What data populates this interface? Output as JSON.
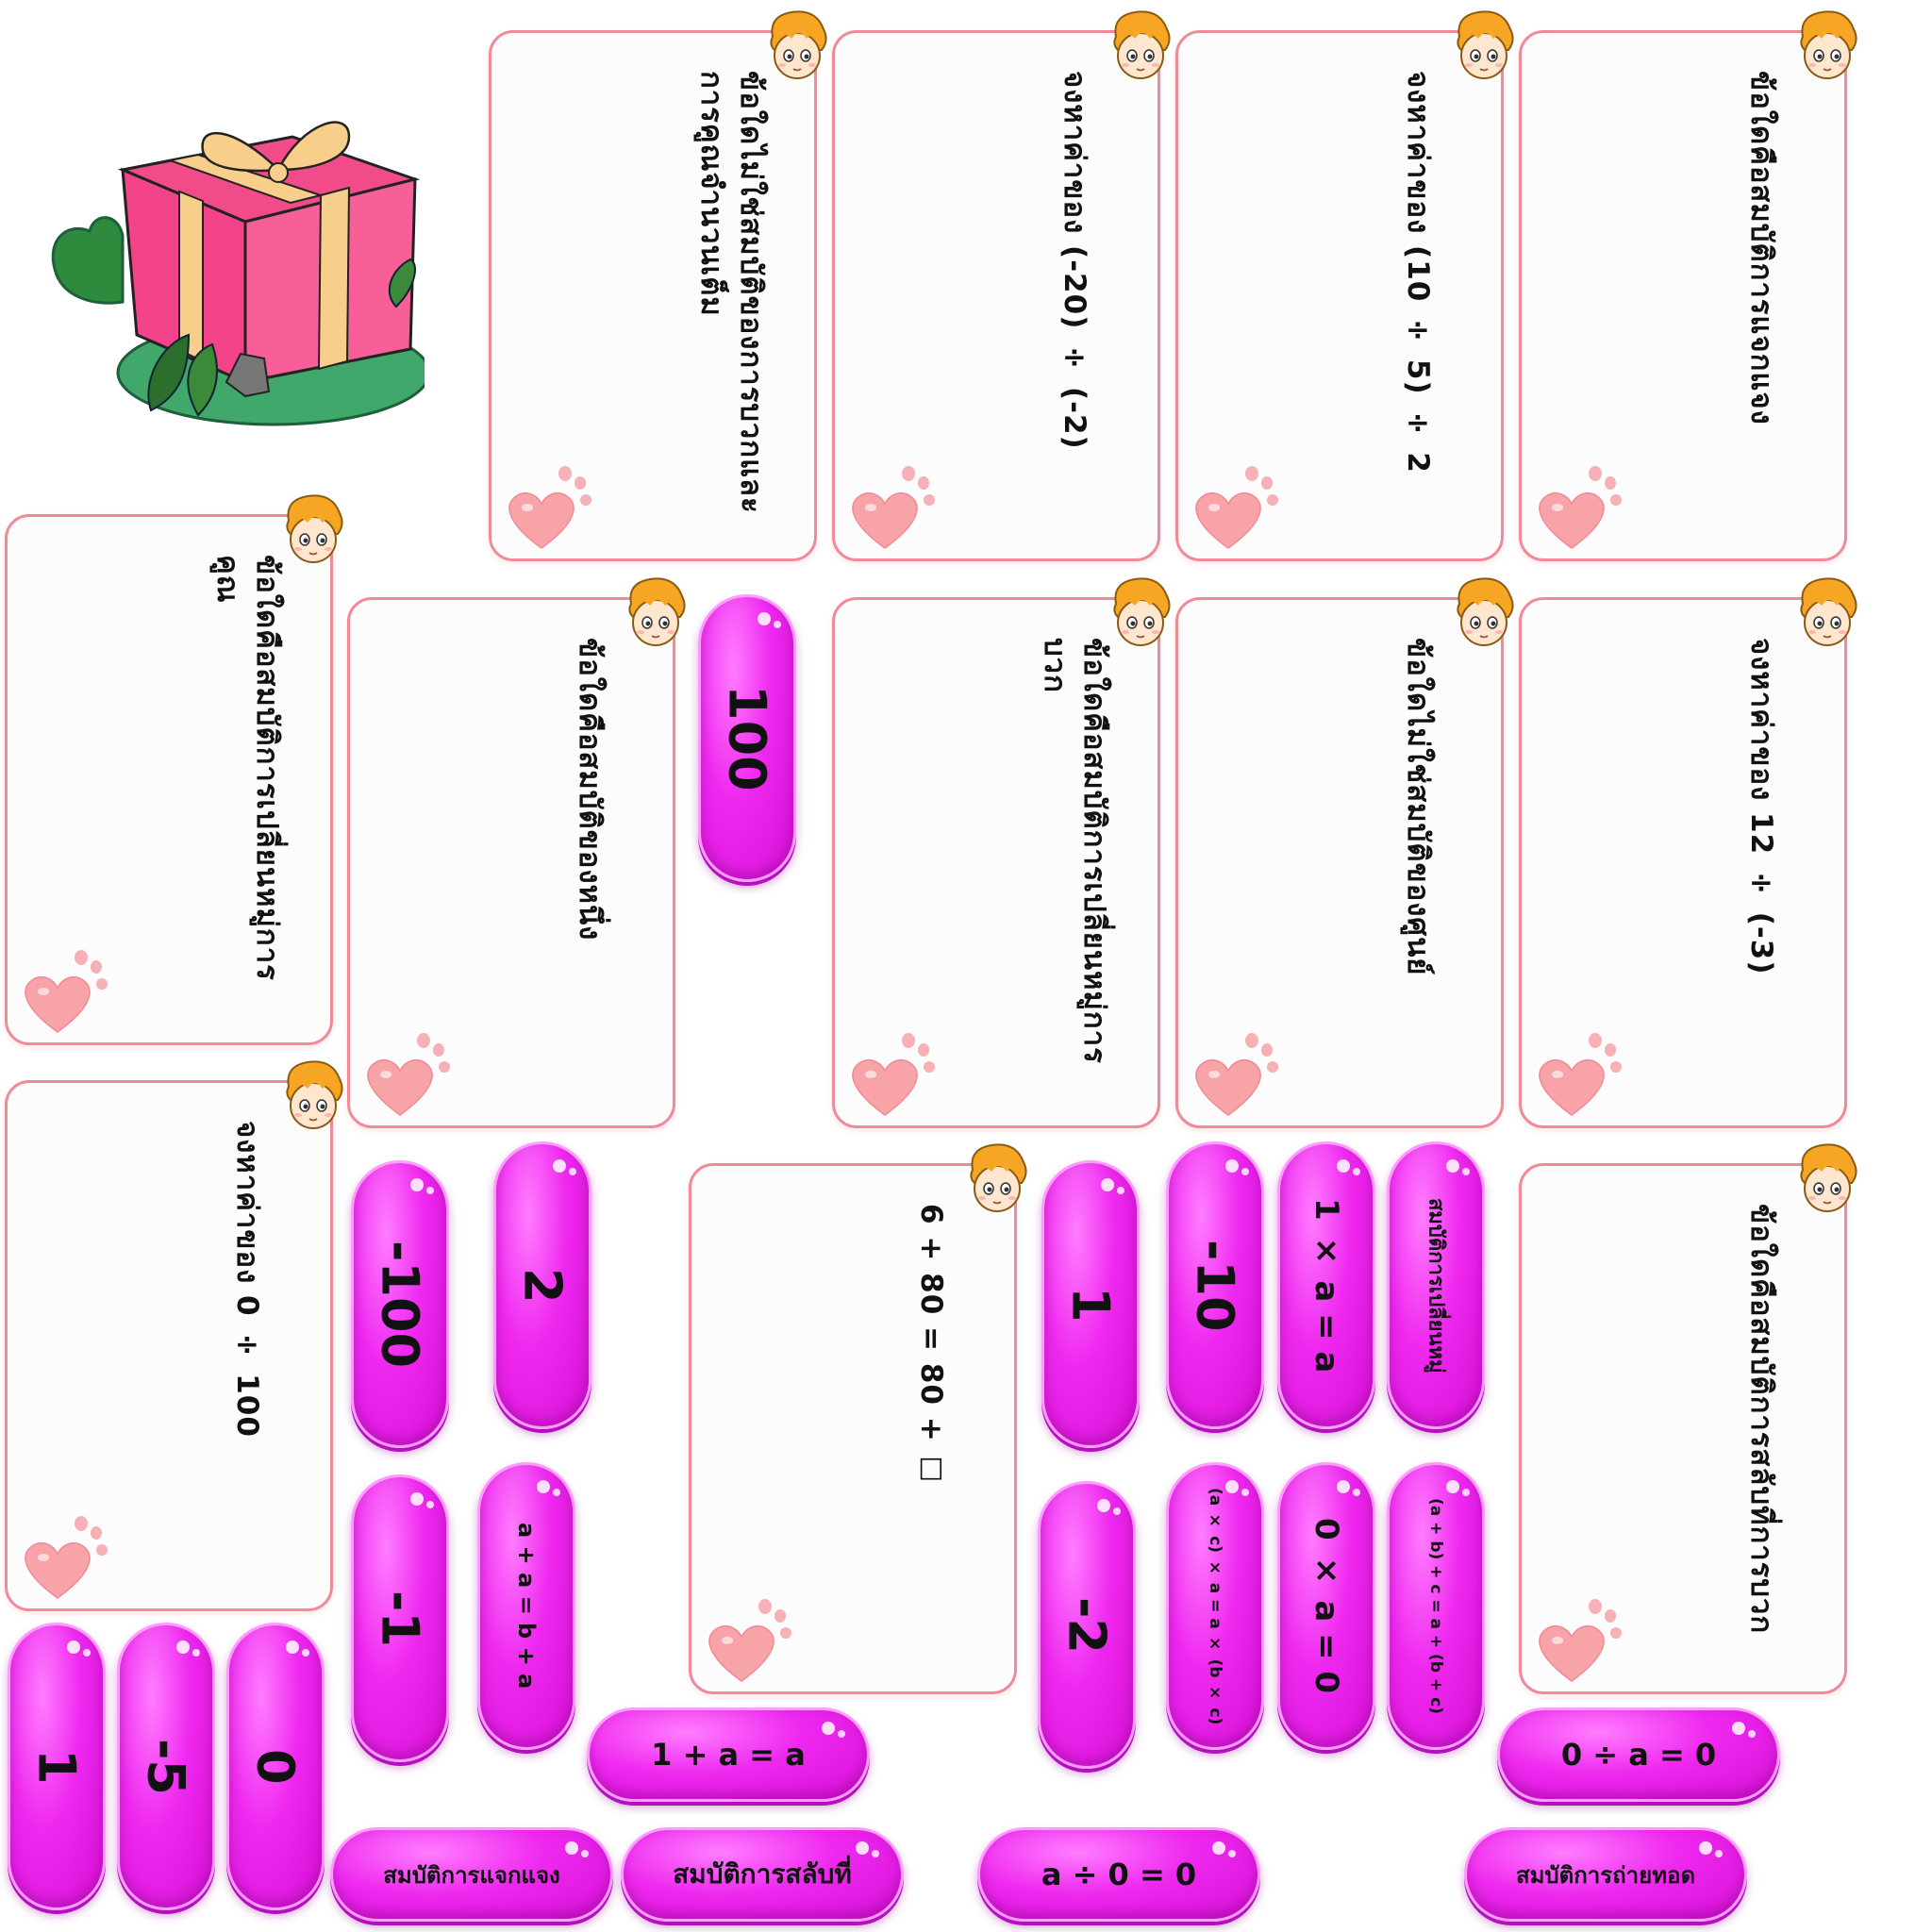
{
  "cards": [
    {
      "id": "c1",
      "question": "ข้อใดไม่ใช่สมบัติของการบวกและการคูณจำนวนเต็ม"
    },
    {
      "id": "c2",
      "question": "จงหาค่าของ (-20) ÷ (-2)"
    },
    {
      "id": "c3",
      "question": "จงหาค่าของ (10 ÷ 5) ÷ 2"
    },
    {
      "id": "c4",
      "question": "ข้อใดคือสมบัติการแจกแจง"
    },
    {
      "id": "c5",
      "question": "ข้อใดคือสมบัติการเปลี่ยนหมู่การคูณ"
    },
    {
      "id": "c6",
      "question": "ข้อใดคือสมบัติของหนึ่ง"
    },
    {
      "id": "c7",
      "question": "ข้อใดคือสมบัติการเปลี่ยนหมู่การบวก"
    },
    {
      "id": "c8",
      "question": "ข้อใดไม่ใช่สมบัติของศูนย์"
    },
    {
      "id": "c9",
      "question": "จงหาค่าของ 12 ÷ (-3)"
    },
    {
      "id": "c10",
      "question": "จงหาค่าของ 0 ÷ 100"
    },
    {
      "id": "c11",
      "question": "6 + 80 = 80 + ☐"
    },
    {
      "id": "c12",
      "question": "ข้อใดคือสมบัติการสลับที่การบวก"
    }
  ],
  "answers": [
    {
      "id": "a1",
      "label": "100"
    },
    {
      "id": "a2",
      "label": "-100"
    },
    {
      "id": "a3",
      "label": "2"
    },
    {
      "id": "a4",
      "label": "1"
    },
    {
      "id": "a5",
      "label": "-10"
    },
    {
      "id": "a6",
      "label": "1 × a = a"
    },
    {
      "id": "a7",
      "label": "สมบัติการเปลี่ยนหมู่"
    },
    {
      "id": "a8",
      "label": "-1"
    },
    {
      "id": "a9",
      "label": "a + a = b + a"
    },
    {
      "id": "a10",
      "label": "-2"
    },
    {
      "id": "a11",
      "label": "(a × c) × a = a × (b × c)"
    },
    {
      "id": "a12",
      "label": "0 × a = 0"
    },
    {
      "id": "a13",
      "label": "(a + b) + c = a + (b + c)"
    },
    {
      "id": "a14",
      "label": "1"
    },
    {
      "id": "a15",
      "label": "-5"
    },
    {
      "id": "a16",
      "label": "0"
    },
    {
      "id": "a17",
      "label": "1 + a = a"
    },
    {
      "id": "a18",
      "label": "0 ÷ a = 0"
    },
    {
      "id": "a19",
      "label": "สมบัติการแจกแจง"
    },
    {
      "id": "a20",
      "label": "สมบัติการสลับที่"
    },
    {
      "id": "a21",
      "label": "a ÷ 0 = 0"
    },
    {
      "id": "a22",
      "label": "สมบัติการถ่ายทอด"
    }
  ],
  "colors": {
    "pill": "#ef28ef",
    "card_border": "#f08a98",
    "text": "#111111"
  },
  "icons": {
    "gift": "gift-box-icon",
    "card_corner": "cartoon-boy-face-icon",
    "card_footer": "pink-paw-heart-icon"
  }
}
